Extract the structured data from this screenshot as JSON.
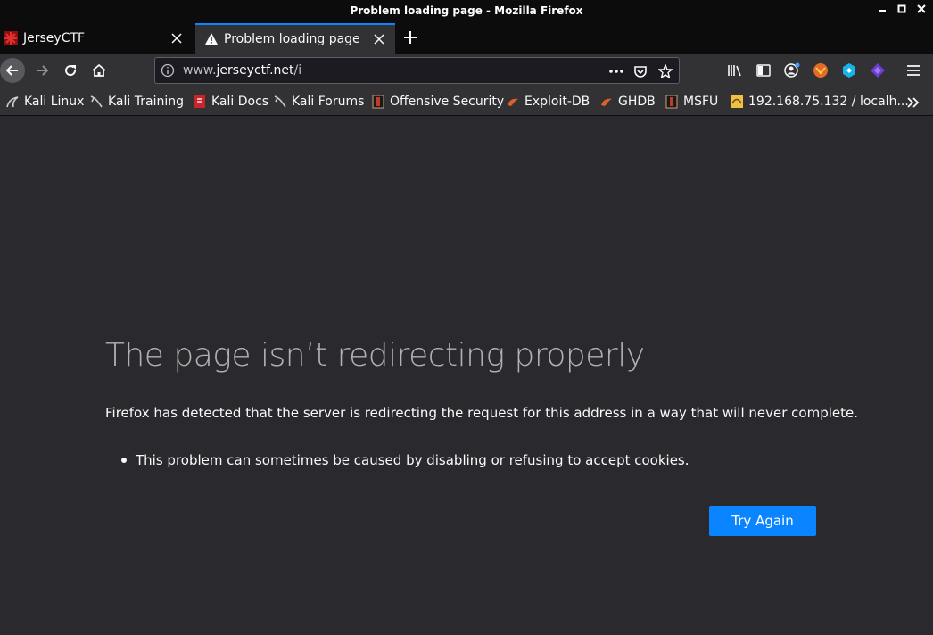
{
  "window": {
    "title": "Problem loading page - Mozilla Firefox"
  },
  "tabs": [
    {
      "label": "JerseyCTF",
      "active": false
    },
    {
      "label": "Problem loading page",
      "active": true
    }
  ],
  "urlbar": {
    "prefix": "www.",
    "host": "jerseyctf.net",
    "path": "/i"
  },
  "bookmarks": [
    {
      "label": "Kali Linux",
      "icon": "kali-dragon-icon"
    },
    {
      "label": "Kali Training",
      "icon": "kali-dragon-icon"
    },
    {
      "label": "Kali Docs",
      "icon": "kali-docs-icon"
    },
    {
      "label": "Kali Forums",
      "icon": "kali-dragon-icon"
    },
    {
      "label": "Offensive Security",
      "icon": "offsec-icon"
    },
    {
      "label": "Exploit-DB",
      "icon": "exploitdb-icon"
    },
    {
      "label": "GHDB",
      "icon": "ghdb-icon"
    },
    {
      "label": "MSFU",
      "icon": "msfu-icon"
    },
    {
      "label": "192.168.75.132 / localh...",
      "icon": "phpmyadmin-icon"
    }
  ],
  "error": {
    "title": "The page isn’t redirecting properly",
    "description": "Firefox has detected that the server is redirecting the request for this address in a way that will never complete.",
    "items": [
      "This problem can sometimes be caused by disabling or refusing to accept cookies."
    ],
    "button": "Try Again"
  },
  "colors": {
    "accent": "#0a84ff",
    "background": "#2a2a2e",
    "toolbar": "#323234",
    "titlebar": "#0c0c0d"
  }
}
